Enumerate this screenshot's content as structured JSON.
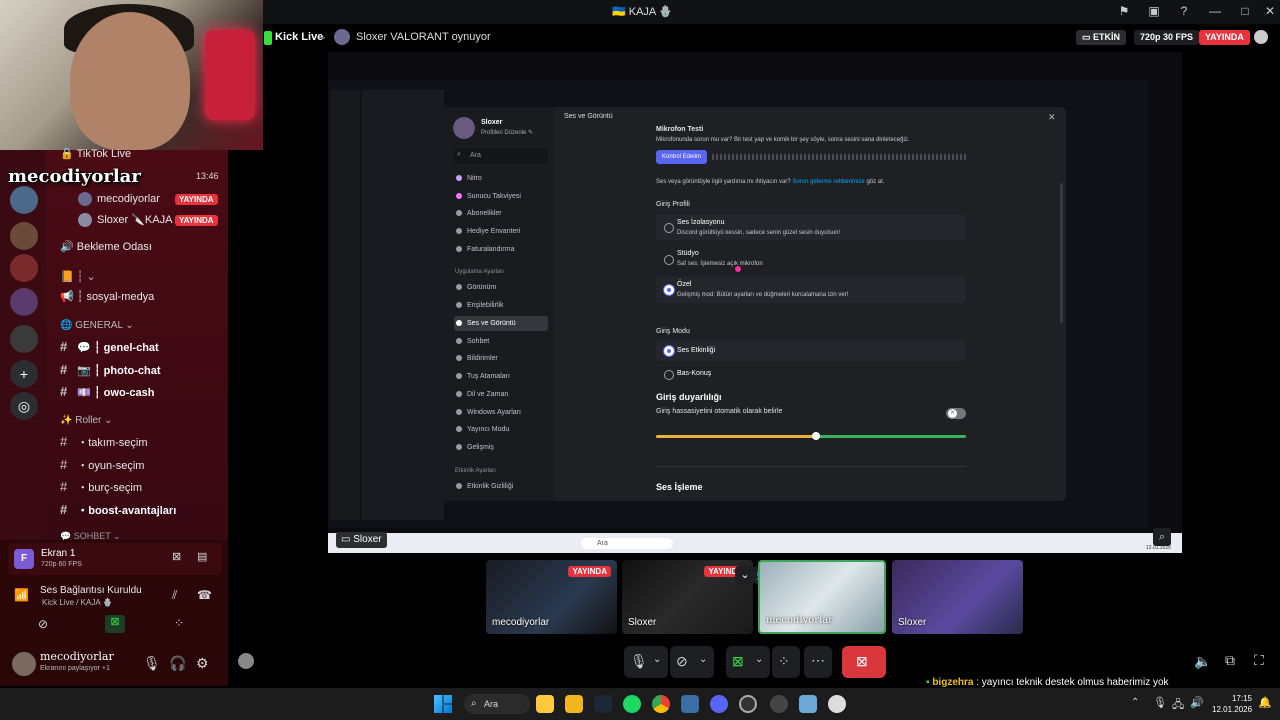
{
  "titlebar": {
    "title": "🇺🇦 KAJA 🪬"
  },
  "stream_header": {
    "kick_live": "Kick Live",
    "game_status": "Sloxer VALORANT oynuyor",
    "etkin_label": "ETKİN",
    "quality_label": "720p 30 FPS",
    "live_label": "YAYINDA"
  },
  "overlay": {
    "streamer_name": "mecodiyorlar"
  },
  "channels": {
    "tiktok_live": "TikTok Live",
    "time": "13:46",
    "voice_users": [
      {
        "name": "mecodiyorlar",
        "badge": "YAYINDA"
      },
      {
        "name": "Sloxer 🔪KAJA",
        "badge": "YAYINDA"
      }
    ],
    "waiting_room": "Bekleme Odası",
    "category_1": "┆ ⌄",
    "social_media": "┆ sosyal-medya",
    "general_category": "GENERAL ⌄",
    "text_channels": [
      "┆ genel-chat",
      "┆ photo-chat",
      "┆ owo-cash"
    ],
    "roles_category": "Roller ⌄",
    "role_channels": [
      "・takım-seçim",
      "・oyun-seçim",
      "・burç-seçim",
      "・boost-avantajları"
    ],
    "sohbet_category": "SOHBET ⌄"
  },
  "screen_share": {
    "title": "Ekran 1",
    "subtitle": "720p 60 FPS"
  },
  "voice_status": {
    "connection": "Ses Bağlantısı Kuruldu",
    "location": "Kick Live / KAJA 🪬"
  },
  "user_panel": {
    "username": "mecodiyorlar",
    "status": "Ekranını paylaşıyor +1"
  },
  "settings": {
    "window_title": "Ses ve Görüntü",
    "profile_name": "Sloxer",
    "profile_edit": "Profilleri Düzenle ✎",
    "search_placeholder": "Ara",
    "nav_top": [
      "Nitro",
      "Sunucu Takviyesi",
      "Abonelikler",
      "Hediye Envanteri",
      "Faturalandırma"
    ],
    "app_settings_header": "Uygulama Ayarları",
    "nav_app": [
      "Görünüm",
      "Erişilebilirlik",
      "Ses ve Görüntü",
      "Sohbet",
      "Bildirimler",
      "Tuş Atamaları",
      "Dil ve Zaman",
      "Windows Ayarları",
      "Yayıncı Modu",
      "Gelişmiş"
    ],
    "activity_header": "Etkinlik Ayarları",
    "nav_activity": [
      "Etkinlik Gizliliği"
    ],
    "mic_test_title": "Mikrofon Testi",
    "mic_test_desc": "Mikrofonunda sorun mu var? Bir test yap ve komik bir şey söyle, sonra sesini sana dinleteceğiz.",
    "mic_test_button": "Kontrol Edelim",
    "help_text": "Ses veya görüntüyle ilgili yardıma mı ihtiyacın var?",
    "help_link": "Sorun giderme rehberimize",
    "help_suffix": "göz at.",
    "input_profile_title": "Giriş Profili",
    "profiles": [
      {
        "name": "Ses İzolasyonu",
        "desc": "Discord gürültüyü kessin, sadece senin güzel sesin duyulsun!"
      },
      {
        "name": "Stüdyo",
        "desc": "Saf ses: İşlemesiz açık mikrofon"
      },
      {
        "name": "Özel",
        "desc": "Gelişmiş mod: Bütün ayarları ve düğmeleri kurcalamana izin ver!"
      }
    ],
    "input_mode_title": "Giriş Modu",
    "modes": [
      "Ses Etkinliği",
      "Bas-Konuş"
    ],
    "sensitivity_title": "Giriş duyarlılığı",
    "auto_sensitivity": "Giriş hassasiyetini otomatik olarak belirle",
    "sensitivity_value": 0.515,
    "processing_title": "Ses İşleme",
    "close_icon": "✕"
  },
  "inner_taskbar": {
    "search": "Ara",
    "date": "12.01.2026"
  },
  "stream_label": "Sloxer",
  "thumbnails": [
    {
      "name": "mecodiyorlar",
      "live": "YAYINDA"
    },
    {
      "name": "Sloxer",
      "live": "YAYINDA"
    },
    {
      "name": "mecodiyorlar",
      "live": ""
    },
    {
      "name": "Sloxer",
      "live": ""
    }
  ],
  "chat": {
    "user": "bigzehra",
    "message": ": yayıncı teknik destek olmus haberimiz yok"
  },
  "taskbar": {
    "search": "Ara",
    "time": "17:15",
    "date": "12.01.2026"
  },
  "colors": {
    "accent": "#5865f2",
    "live": "#e8333d",
    "kick": "#37e03f",
    "sidebar": "#4a0b14"
  }
}
